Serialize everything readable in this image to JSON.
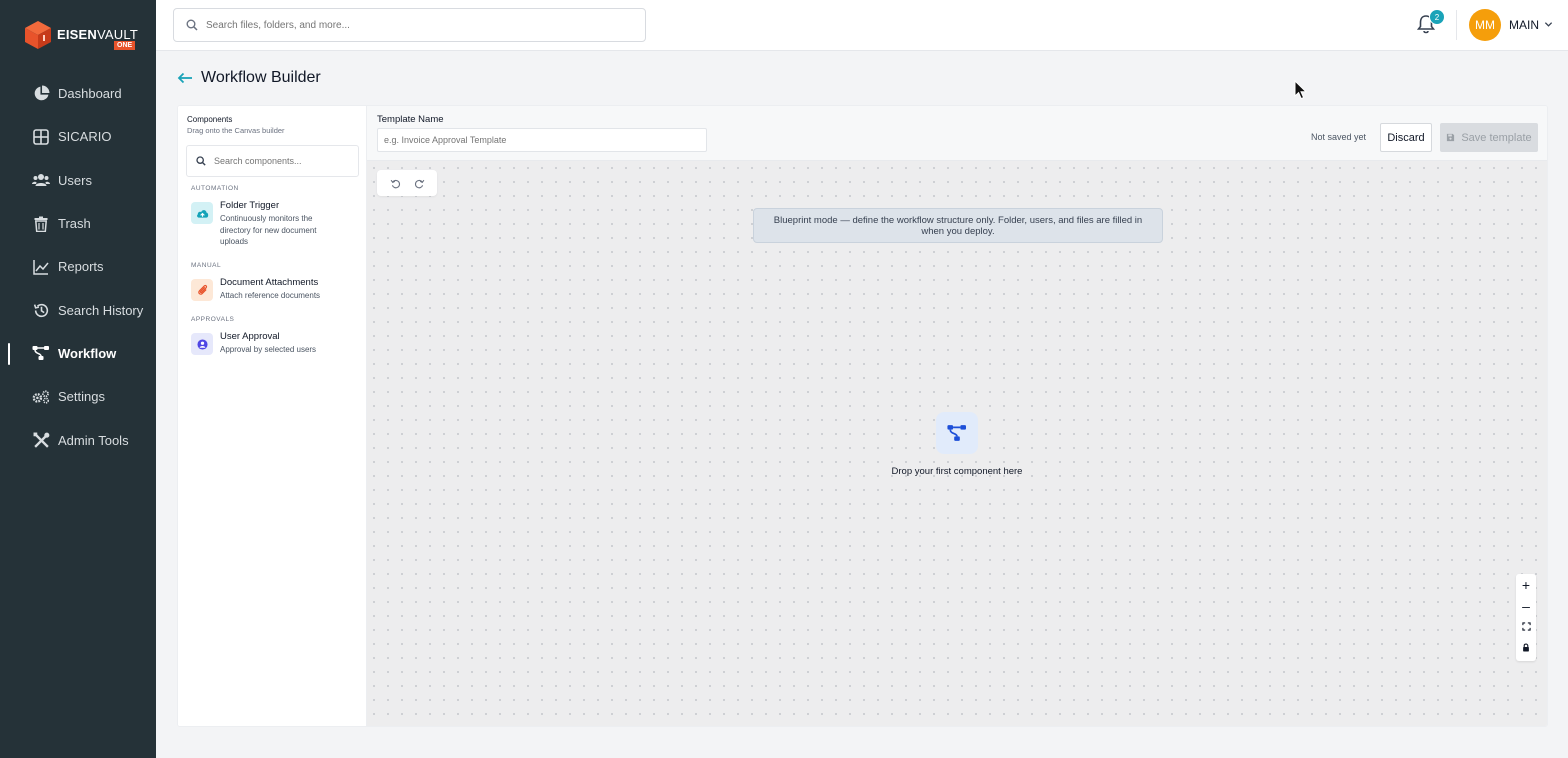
{
  "brand": {
    "name_bold": "EISEN",
    "name_light": "VAULT",
    "suffix": "ONE",
    "accent": "#e8532b"
  },
  "sidebar": {
    "items": [
      {
        "label": "Dashboard",
        "icon": "pie-chart-icon"
      },
      {
        "label": "SICARIO",
        "icon": "grid-icon"
      },
      {
        "label": "Users",
        "icon": "users-icon"
      },
      {
        "label": "Trash",
        "icon": "trash-icon"
      },
      {
        "label": "Reports",
        "icon": "line-chart-icon"
      },
      {
        "label": "Search History",
        "icon": "history-icon"
      },
      {
        "label": "Workflow",
        "icon": "workflow-icon",
        "active": true
      },
      {
        "label": "Settings",
        "icon": "gears-icon"
      },
      {
        "label": "Admin Tools",
        "icon": "tools-icon"
      }
    ]
  },
  "header": {
    "search_placeholder": "Search files, folders, and more...",
    "notification_count": "2",
    "avatar_initials": "MM",
    "account_label": "MAIN"
  },
  "page": {
    "title": "Workflow Builder"
  },
  "components_panel": {
    "title": "Components",
    "subtitle": "Drag onto the Canvas builder",
    "search_placeholder": "Search components...",
    "groups": [
      {
        "label": "AUTOMATION",
        "items": [
          {
            "name": "Folder Trigger",
            "description": "Continuously monitors the directory for new document uploads",
            "icon": "cloud-upload-icon",
            "color": "#14a3b8"
          }
        ]
      },
      {
        "label": "MANUAL",
        "items": [
          {
            "name": "Document Attachments",
            "description": "Attach reference documents",
            "icon": "paperclip-icon",
            "color": "#e8532b"
          }
        ]
      },
      {
        "label": "APPROVALS",
        "items": [
          {
            "name": "User Approval",
            "description": "Approval by selected users",
            "icon": "user-circle-icon",
            "color": "#4f46e5"
          }
        ]
      }
    ]
  },
  "template": {
    "label": "Template Name",
    "placeholder": "e.g. Invoice Approval Template",
    "status": "Not saved yet",
    "discard_label": "Discard",
    "save_label": "Save template"
  },
  "canvas": {
    "notice": "Blueprint mode — define the workflow structure only. Folder, users, and files are filled in when you deploy.",
    "empty_text": "Drop your first component here",
    "zoom_in": "+",
    "zoom_out": "–"
  }
}
